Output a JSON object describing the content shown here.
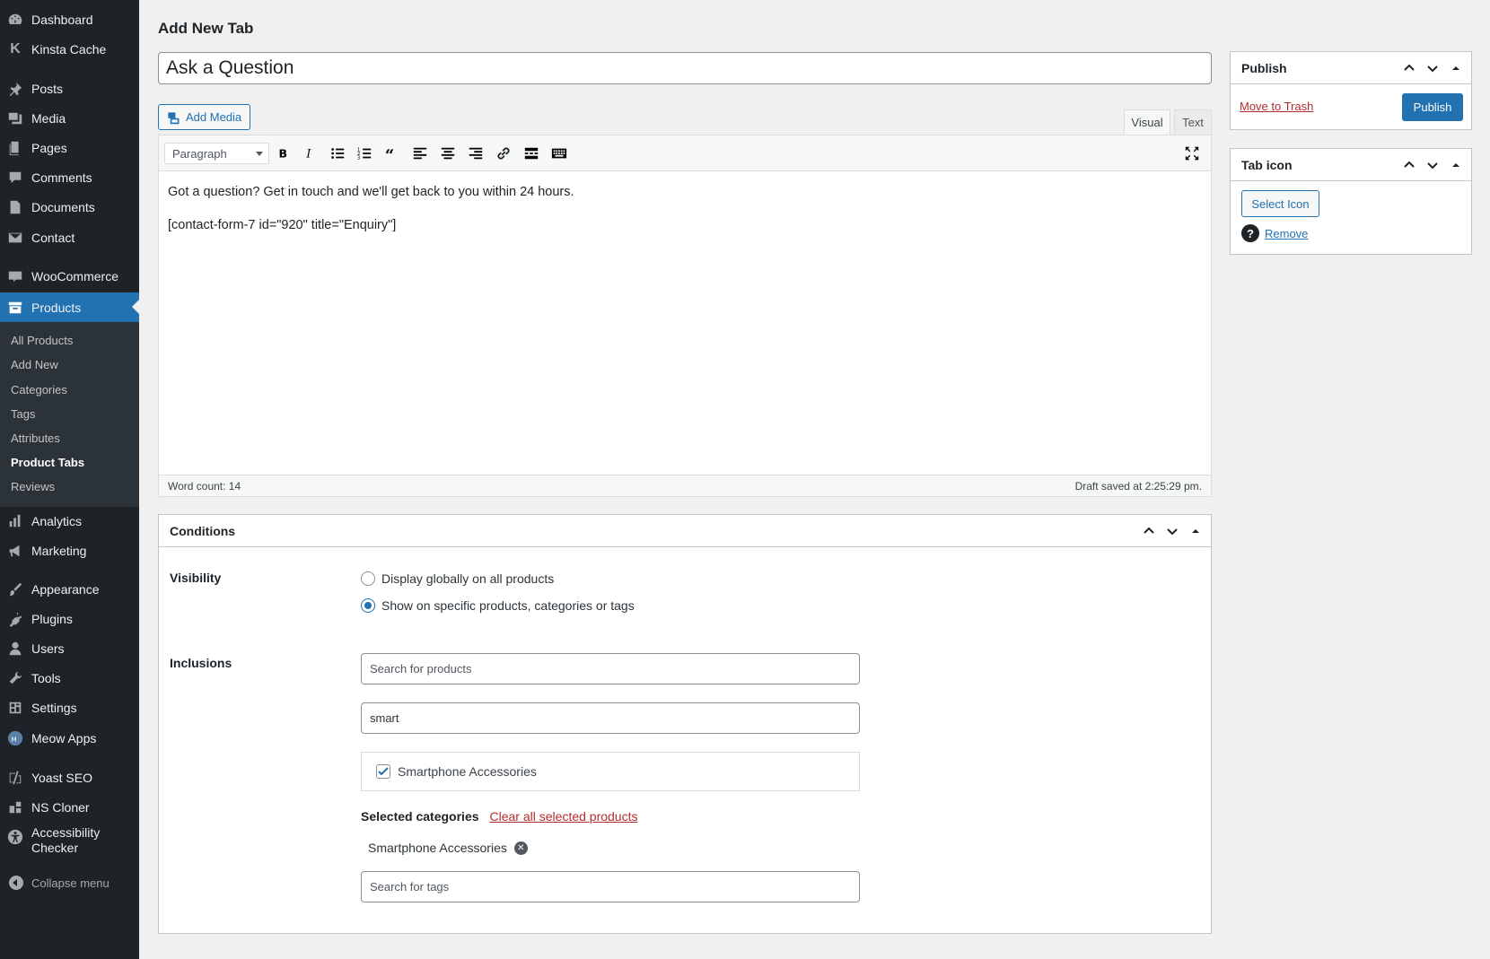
{
  "sidebar": {
    "items": [
      {
        "label": "Dashboard",
        "icon": "dashboard-icon"
      },
      {
        "label": "Kinsta Cache",
        "icon": "kinsta-icon"
      },
      {
        "label": "Posts",
        "icon": "pushpin-icon"
      },
      {
        "label": "Media",
        "icon": "media-icon"
      },
      {
        "label": "Pages",
        "icon": "pages-icon"
      },
      {
        "label": "Comments",
        "icon": "comments-icon"
      },
      {
        "label": "Documents",
        "icon": "documents-icon"
      },
      {
        "label": "Contact",
        "icon": "envelope-icon"
      },
      {
        "label": "WooCommerce",
        "icon": "woocommerce-icon"
      },
      {
        "label": "Products",
        "icon": "archive-icon"
      },
      {
        "label": "Analytics",
        "icon": "bar-chart-icon"
      },
      {
        "label": "Marketing",
        "icon": "megaphone-icon"
      },
      {
        "label": "Appearance",
        "icon": "paintbrush-icon"
      },
      {
        "label": "Plugins",
        "icon": "plugin-icon"
      },
      {
        "label": "Users",
        "icon": "users-icon"
      },
      {
        "label": "Tools",
        "icon": "wrench-icon"
      },
      {
        "label": "Settings",
        "icon": "settings-icon"
      },
      {
        "label": "Meow Apps",
        "icon": "meow-icon"
      },
      {
        "label": "Yoast SEO",
        "icon": "yoast-icon"
      },
      {
        "label": "NS Cloner",
        "icon": "cloner-icon"
      },
      {
        "label": "Accessibility Checker",
        "label_line1": "Accessibility",
        "label_line2": "Checker",
        "icon": "accessibility-icon"
      }
    ],
    "submenu": [
      "All Products",
      "Add New",
      "Categories",
      "Tags",
      "Attributes",
      "Product Tabs",
      "Reviews"
    ],
    "collapse_label": "Collapse menu"
  },
  "page": {
    "title": "Add New Tab",
    "post_title": "Ask a Question"
  },
  "editor": {
    "add_media_label": "Add Media",
    "tab_visual": "Visual",
    "tab_text": "Text",
    "format_selected": "Paragraph",
    "content_line1": "Got a question? Get in touch and we'll get back to you within 24 hours.",
    "content_line2": "[contact-form-7 id=\"920\" title=\"Enquiry\"]",
    "word_count": "Word count: 14",
    "draft_saved": "Draft saved at 2:25:29 pm."
  },
  "conditions": {
    "title": "Conditions",
    "visibility_label": "Visibility",
    "radio_global": "Display globally on all products",
    "radio_specific": "Show on specific products, categories or tags",
    "selected_radio": "specific",
    "inclusions_label": "Inclusions",
    "search_products_placeholder": "Search for products",
    "category_search_value": "smart",
    "result_item": "Smartphone Accessories",
    "result_checked": true,
    "selected_categories_label": "Selected categories",
    "clear_all_label": "Clear all selected products",
    "selected_chip": "Smartphone Accessories",
    "search_tags_placeholder": "Search for tags"
  },
  "publish": {
    "title": "Publish",
    "trash_label": "Move to Trash",
    "publish_label": "Publish"
  },
  "tab_icon": {
    "title": "Tab icon",
    "select_label": "Select Icon",
    "remove_label": "Remove"
  },
  "colors": {
    "admin_bar": "#1d2327",
    "accent": "#2271b1",
    "danger": "#b32d2e"
  }
}
